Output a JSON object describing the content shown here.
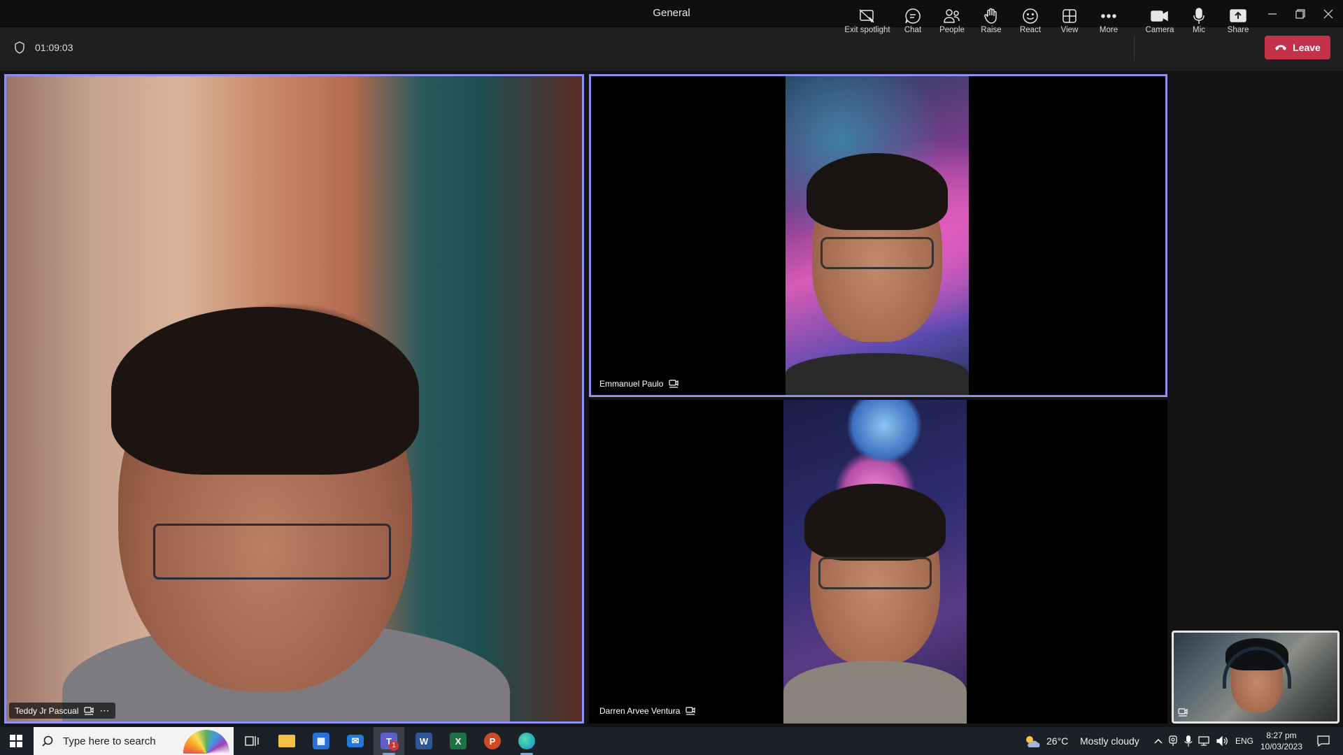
{
  "window": {
    "title": "General"
  },
  "meeting": {
    "timer": "01:09:03",
    "tools": [
      {
        "label": "Exit spotlight",
        "icon": "exit-spotlight-icon"
      },
      {
        "label": "Chat",
        "icon": "chat-icon"
      },
      {
        "label": "People",
        "icon": "people-icon"
      },
      {
        "label": "Raise",
        "icon": "raise-hand-icon"
      },
      {
        "label": "React",
        "icon": "react-icon"
      },
      {
        "label": "View",
        "icon": "view-icon"
      },
      {
        "label": "More",
        "icon": "more-icon"
      },
      {
        "label": "Camera",
        "icon": "camera-icon"
      },
      {
        "label": "Mic",
        "icon": "mic-icon"
      },
      {
        "label": "Share",
        "icon": "share-icon"
      }
    ],
    "leave_label": "Leave",
    "leave_color": "#c4314b",
    "spotlight_color": "#8f8ff0"
  },
  "participants": [
    {
      "name": "Teddy Jr Pascual"
    },
    {
      "name": "Emmanuel Paulo"
    },
    {
      "name": "Darren Arvee Ventura"
    }
  ],
  "taskbar": {
    "search_placeholder": "Type here to search",
    "apps": [
      "start-icon",
      "task-view-icon",
      "file-explorer-icon",
      "store-icon",
      "mail-icon",
      "teams-icon",
      "word-icon",
      "excel-icon",
      "powerpoint-icon",
      "edge-icon"
    ],
    "teams_badge": "1",
    "weather_temp": "26°C",
    "weather_text": "Mostly cloudy",
    "language": "ENG",
    "time": "8:27 pm",
    "date": "10/03/2023"
  }
}
